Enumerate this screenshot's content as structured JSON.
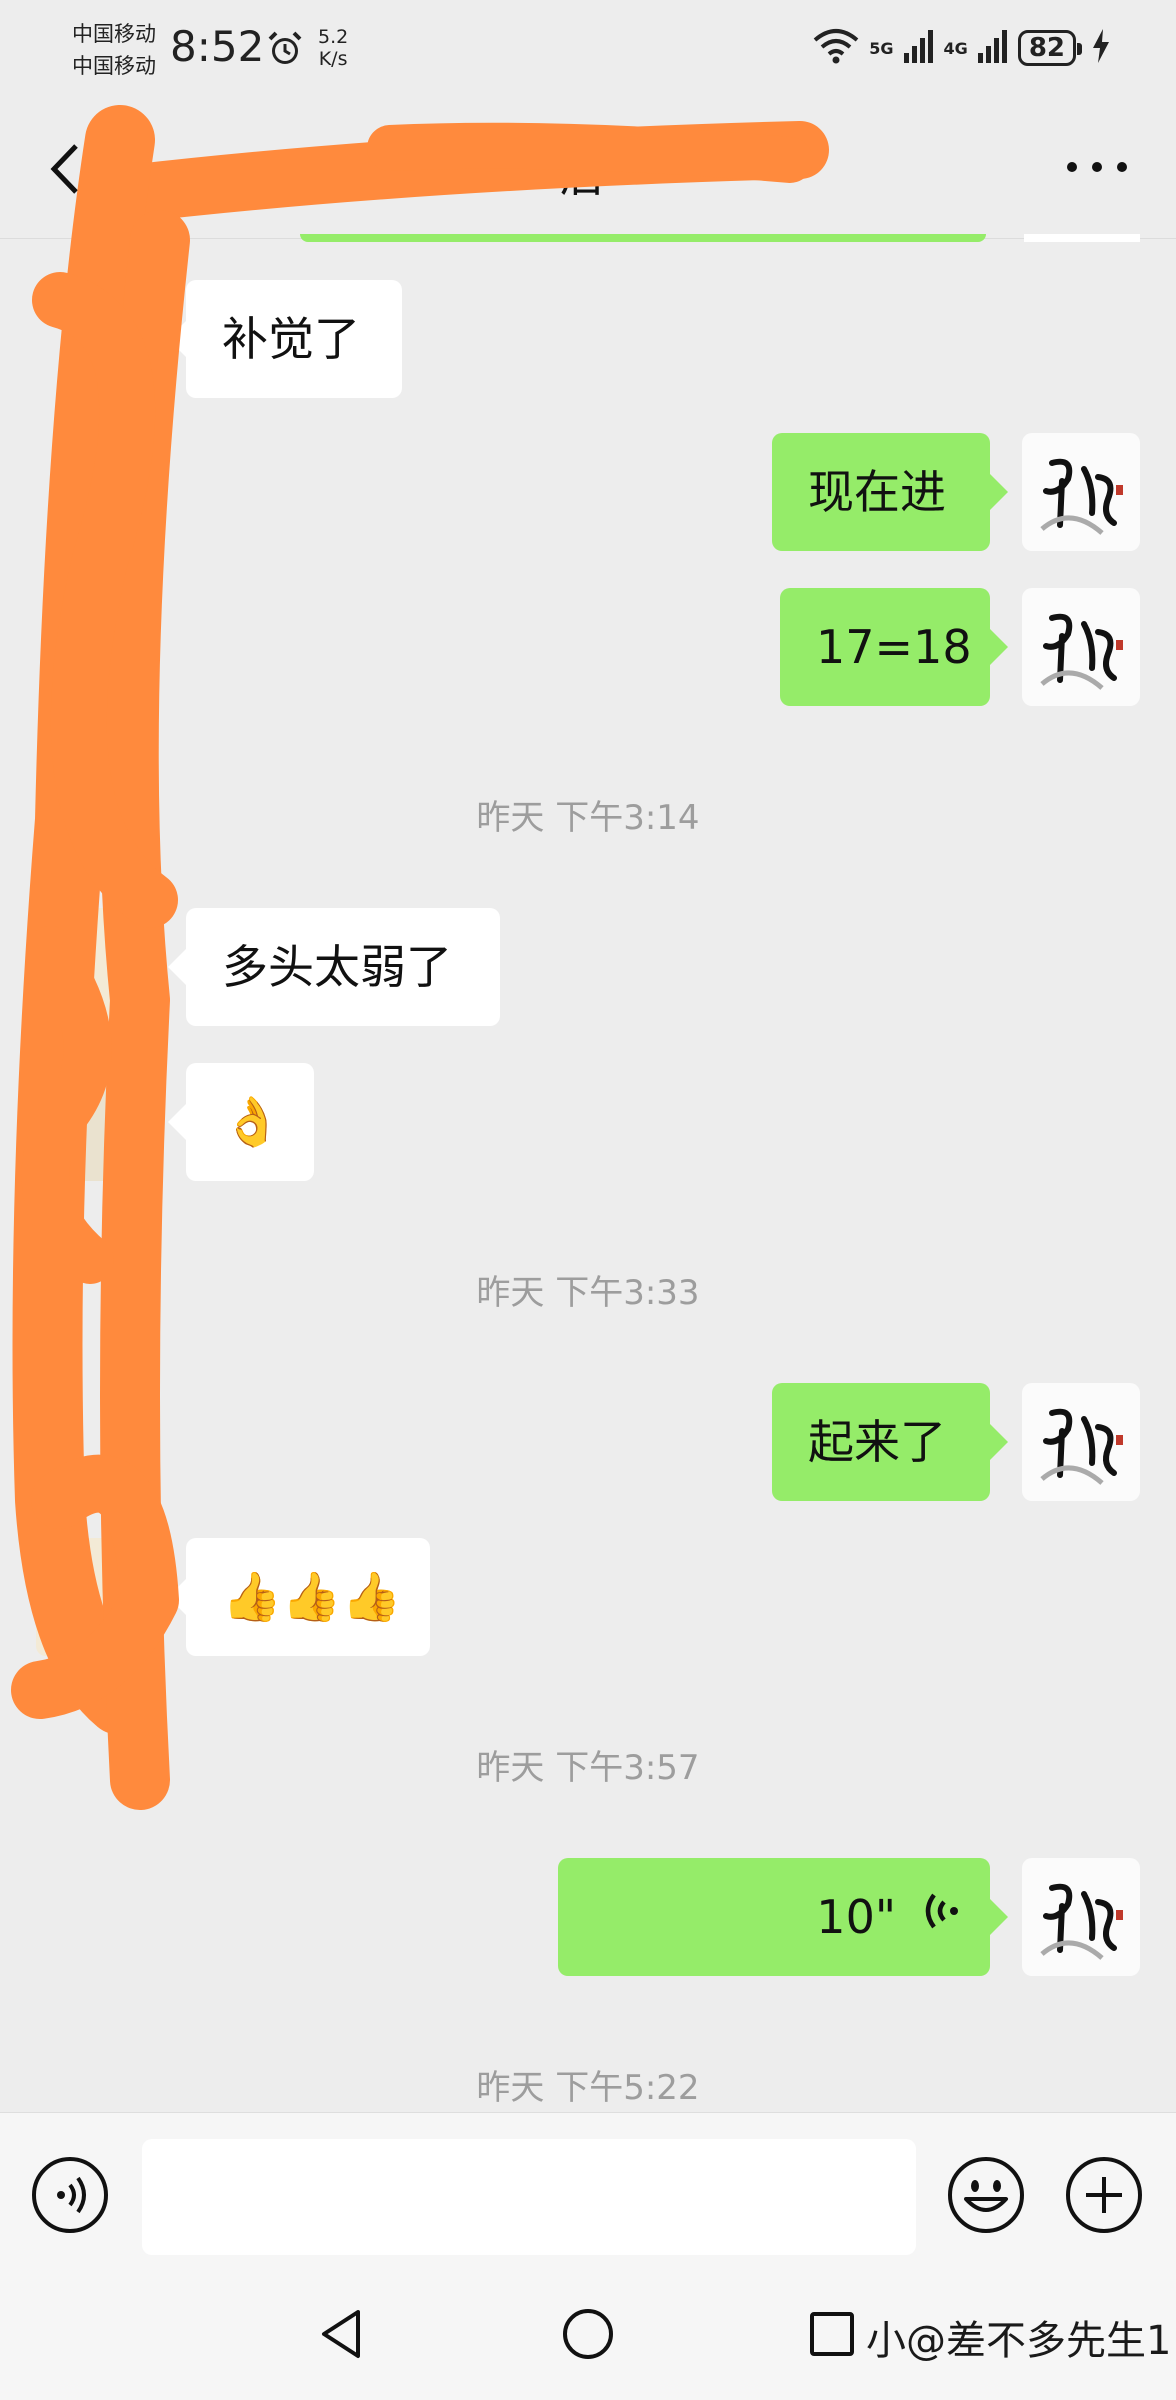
{
  "status_bar": {
    "carrier_1": "中国移动",
    "carrier_2": "中国移动",
    "time": "8:52",
    "speed_value": "5.2",
    "speed_unit": "K/s",
    "net_1": "5G",
    "net_2": "4G",
    "battery": "82"
  },
  "header": {
    "title_visible": "后"
  },
  "messages": [
    {
      "side": "in",
      "text": "补觉了"
    },
    {
      "side": "out",
      "text": "现在进"
    },
    {
      "side": "out",
      "text": "17=18"
    },
    {
      "side": "timestamp",
      "text": "昨天 下午3:14"
    },
    {
      "side": "in",
      "text": "多头太弱了"
    },
    {
      "side": "in",
      "text": "👌"
    },
    {
      "side": "timestamp",
      "text": "昨天 下午3:33"
    },
    {
      "side": "out",
      "text": "起来了"
    },
    {
      "side": "in",
      "text": "👍👍👍"
    },
    {
      "side": "timestamp",
      "text": "昨天 下午3:57"
    },
    {
      "side": "out",
      "type": "voice",
      "text": "10\""
    },
    {
      "side": "timestamp",
      "text": "昨天 下午5:22"
    }
  ],
  "input_bar": {
    "placeholder": "",
    "voice_icon": "voice-toggle-icon",
    "emoji_icon": "emoji-icon",
    "plus_icon": "plus-icon"
  },
  "nav_bar": {
    "watermark": "小@差不多先生1"
  },
  "colors": {
    "background": "#ededed",
    "bubble_out": "#95ec69",
    "bubble_in": "#ffffff",
    "timestamp": "#9d9d9d",
    "redaction": "#ff8a3d"
  }
}
